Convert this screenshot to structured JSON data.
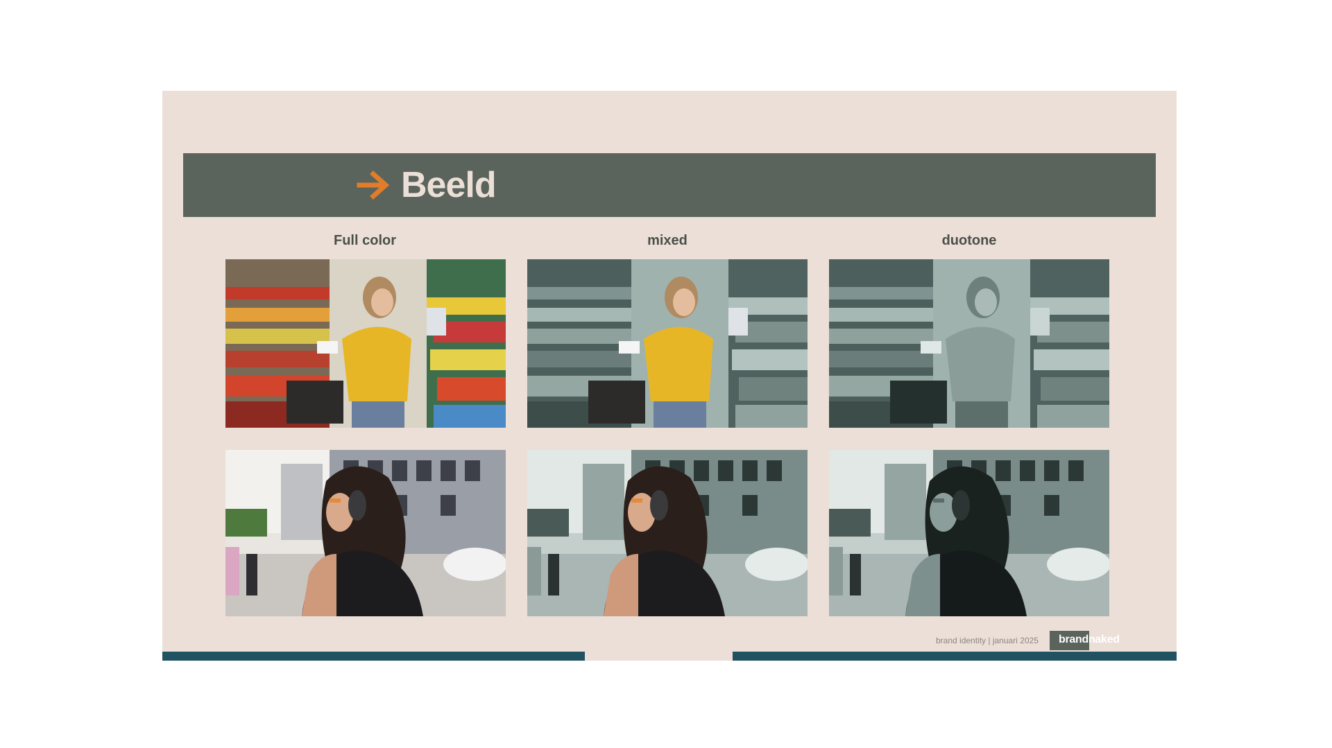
{
  "slide": {
    "title": "Beeld",
    "arrow_icon": "arrow-right-icon",
    "colors": {
      "background": "#ecdfd7",
      "header": "#5a645c",
      "accent": "#e07c2a",
      "bar": "#215262"
    }
  },
  "columns": [
    {
      "label": "Full color"
    },
    {
      "label": "mixed"
    },
    {
      "label": "duotone"
    }
  ],
  "footer": {
    "caption": "brand identity | januari 2025",
    "brand": "brandnaked"
  }
}
